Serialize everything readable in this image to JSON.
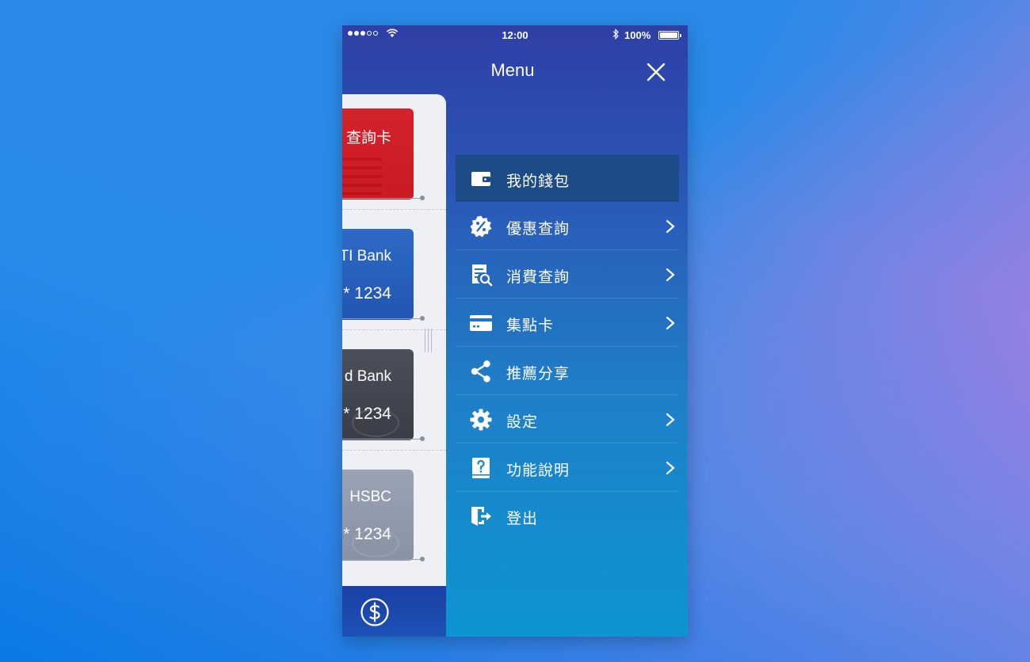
{
  "status_bar": {
    "time": "12:00",
    "battery": "100%"
  },
  "header": {
    "title": "Menu",
    "close_icon": "close-icon"
  },
  "cards": [
    {
      "name": "查詢卡",
      "number": "",
      "color": "#d5222a"
    },
    {
      "name": "TI Bank",
      "number": "* 1234",
      "color": "#2e6ac7"
    },
    {
      "name": "d Bank",
      "number": "* 1234",
      "color": "#4b4f5a"
    },
    {
      "name": "HSBC",
      "number": "* 1234",
      "color": "#9aa3b4"
    }
  ],
  "bottom_bar": {
    "icon": "dollar-icon"
  },
  "menu": {
    "items": [
      {
        "label": "我的錢包",
        "icon": "wallet-icon",
        "active": true,
        "chevron": false
      },
      {
        "label": "優惠查詢",
        "icon": "discount-badge-icon",
        "active": false,
        "chevron": true
      },
      {
        "label": "消費查詢",
        "icon": "receipt-search-icon",
        "active": false,
        "chevron": true
      },
      {
        "label": "集點卡",
        "icon": "card-icon",
        "active": false,
        "chevron": true
      },
      {
        "label": "推薦分享",
        "icon": "share-icon",
        "active": false,
        "chevron": false
      },
      {
        "label": "設定",
        "icon": "gear-icon",
        "active": false,
        "chevron": true
      },
      {
        "label": "功能說明",
        "icon": "help-book-icon",
        "active": false,
        "chevron": true
      },
      {
        "label": "登出",
        "icon": "logout-door-icon",
        "active": false,
        "chevron": false
      }
    ]
  },
  "colors": {
    "active_item": "#1d4b88",
    "menu_gradient_top": "#2e3fa6",
    "menu_gradient_bottom": "#0d95d2"
  }
}
